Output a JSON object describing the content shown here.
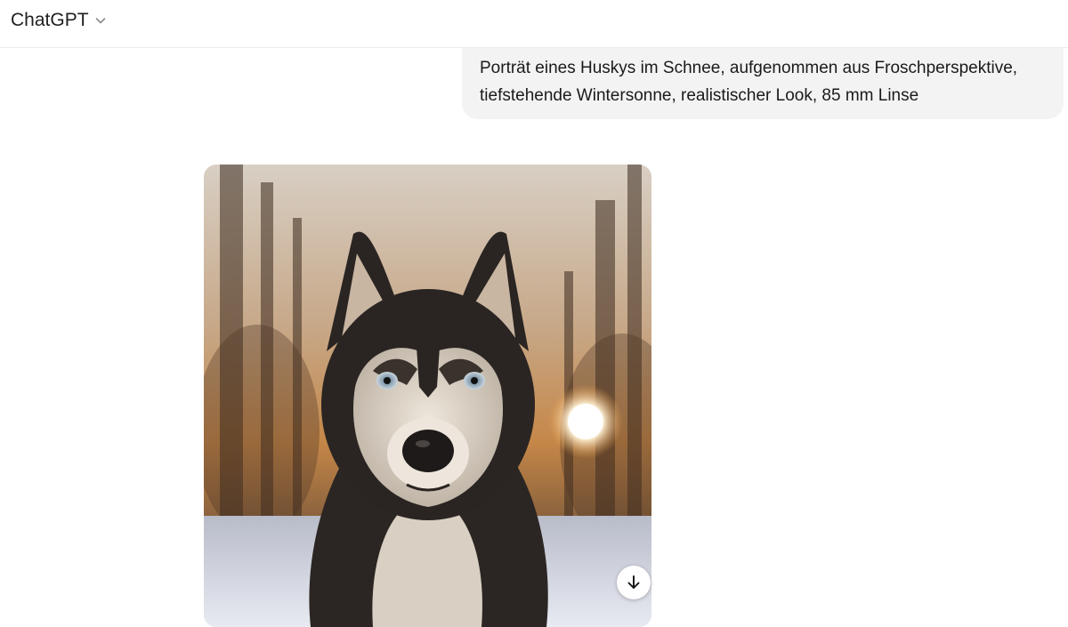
{
  "header": {
    "model_name": "ChatGPT",
    "chevron_icon": "chevron-down-icon"
  },
  "conversation": {
    "user_message": {
      "line1": "Porträt eines Huskys im Schnee, aufgenommen aus Froschperspektive,",
      "line2": "tiefstehende Wintersonne, realistischer Look, 85 mm Linse"
    },
    "assistant_image": {
      "download_icon": "arrow-down-icon"
    }
  }
}
